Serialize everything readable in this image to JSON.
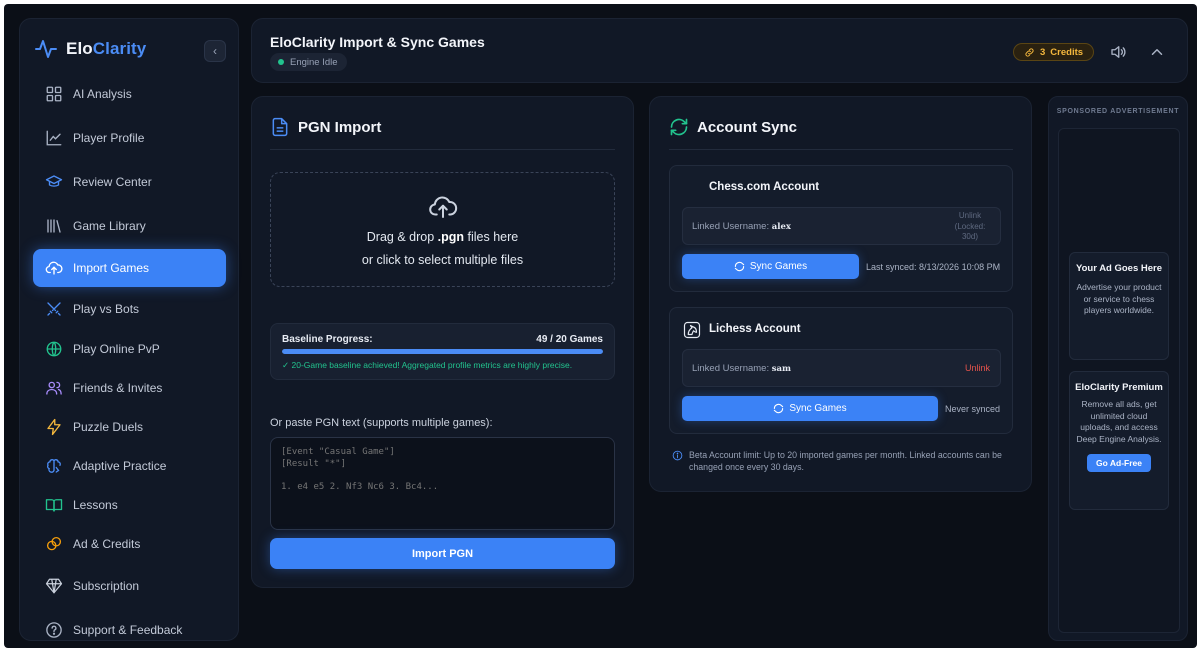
{
  "brand": {
    "name_part1": "Elo",
    "name_part2": "Clarity"
  },
  "sidebar": {
    "items": [
      {
        "label": "AI Analysis",
        "icon": "grid-icon"
      },
      {
        "label": "Player Profile",
        "icon": "chart-line-icon"
      },
      {
        "label": "Review Center",
        "icon": "graduation-cap-icon"
      },
      {
        "label": "Game Library",
        "icon": "library-icon"
      },
      {
        "label": "Import Games",
        "icon": "cloud-upload-icon",
        "active": true
      },
      {
        "label": "Play vs Bots",
        "icon": "swords-icon"
      },
      {
        "label": "Play Online PvP",
        "icon": "globe-icon"
      },
      {
        "label": "Friends & Invites",
        "icon": "users-icon"
      },
      {
        "label": "Puzzle Duels",
        "icon": "lightning-icon"
      },
      {
        "label": "Adaptive Practice",
        "icon": "brain-icon"
      },
      {
        "label": "Lessons",
        "icon": "book-icon"
      },
      {
        "label": "Ad & Credits",
        "icon": "coins-icon"
      },
      {
        "label": "Subscription",
        "icon": "gem-icon"
      },
      {
        "label": "Support & Feedback",
        "icon": "help-circle-icon"
      }
    ]
  },
  "header": {
    "title": "EloClarity Import & Sync Games",
    "engine_status": "Engine Idle",
    "credits_count": "3",
    "credits_label": "Credits"
  },
  "pgn_import": {
    "title": "PGN Import",
    "drop_prefix": "Drag & drop ",
    "drop_ext": ".pgn",
    "drop_suffix": " files here",
    "drop_line2": "or click to select multiple files",
    "baseline_label": "Baseline Progress:",
    "baseline_count": "49 / 20 Games",
    "baseline_fraction": 1.0,
    "baseline_note": "✓ 20-Game baseline achieved! Aggregated profile metrics are highly precise.",
    "paste_label": "Or paste PGN text (supports multiple games):",
    "paste_placeholder": "[Event \"Casual Game\"]\n[Result \"*\"]\n\n1. e4 e5 2. Nf3 Nc6 3. Bc4...",
    "import_button": "Import PGN"
  },
  "account_sync": {
    "title": "Account Sync",
    "chesscom": {
      "name": "Chess.com Account",
      "linked_label": "Linked Username: ",
      "username": "alex",
      "unlink_text": "Unlink (Locked: 30d)",
      "sync_button": "Sync Games",
      "status": "Last synced: 8/13/2026 10:08 PM"
    },
    "lichess": {
      "name": "Lichess Account",
      "linked_label": "Linked Username: ",
      "username": "sam",
      "unlink_text": "Unlink",
      "sync_button": "Sync Games",
      "status": "Never synced"
    },
    "beta_note": "Beta Account limit: Up to 20 imported games per month. Linked accounts can be changed once every 30 days."
  },
  "ads": {
    "heading": "SPONSORED ADVERTISEMENT",
    "ad_title": "Your Ad Goes Here",
    "ad_text": "Advertise your product or service to chess players worldwide.",
    "premium_title": "EloClarity Premium",
    "premium_text": "Remove all ads, get unlimited cloud uploads, and access Deep Engine Analysis.",
    "premium_button": "Go Ad-Free"
  },
  "colors": {
    "accent": "#3b82f6",
    "success": "#22c38e",
    "credits": "#f5b83d",
    "danger": "#e5534b"
  }
}
